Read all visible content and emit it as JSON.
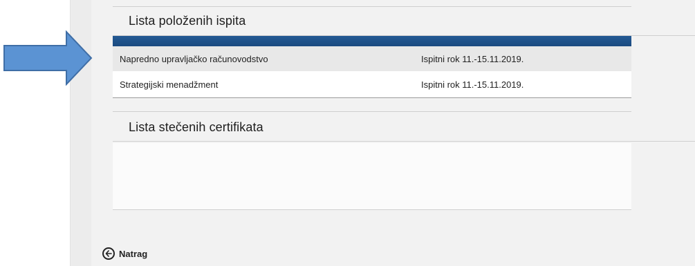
{
  "sections": {
    "passed_exams": {
      "title": "Lista položenih ispita",
      "rows": [
        {
          "course": "Napredno upravljačko računovodstvo",
          "term": "Ispitni rok 11.-15.11.2019."
        },
        {
          "course": "Strategijski menadžment",
          "term": "Ispitni rok 11.-15.11.2019."
        }
      ]
    },
    "certificates": {
      "title": "Lista stečenih certifikata",
      "rows": []
    }
  },
  "back_link": {
    "label": "Natrag",
    "icon": "arrow-left-circle-icon"
  },
  "annotation": {
    "icon": "pointer-arrow-icon",
    "color": "#5b93d3"
  },
  "colors": {
    "table_header": "#1f5089",
    "row_alt": "#e8e8e8",
    "panel_bg": "#f2f2f2"
  }
}
